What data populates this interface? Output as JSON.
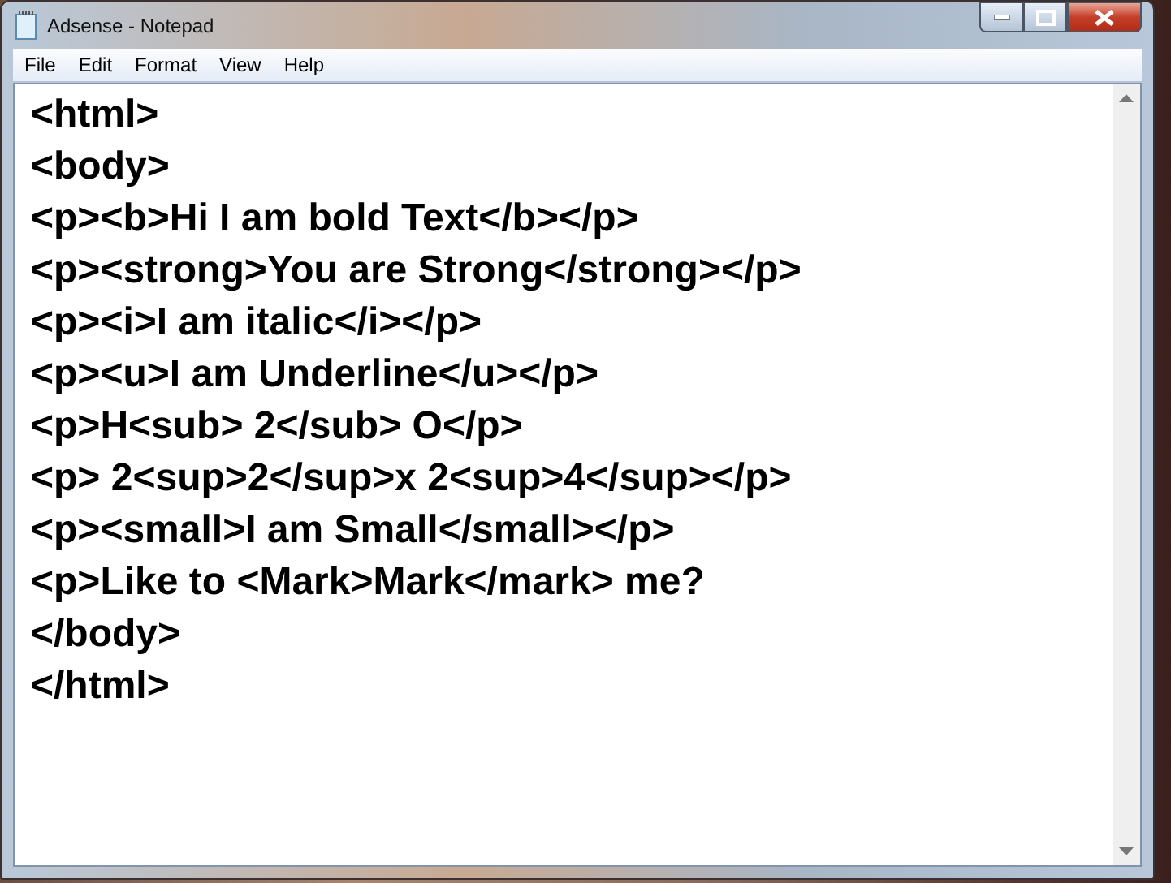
{
  "window": {
    "title": "Adsense - Notepad"
  },
  "menu": [
    "File",
    "Edit",
    "Format",
    "View",
    "Help"
  ],
  "editor": {
    "lines": [
      "<html>",
      "<body>",
      "<p><b>Hi I am bold Text</b></p>",
      "<p><strong>You are Strong</strong></p>",
      "<p><i>I am italic</i></p>",
      "<p><u>I am Underline</u></p>",
      "<p>H<sub> 2</sub> O</p>",
      "<p> 2<sup>2</sup>x 2<sup>4</sup></p>",
      "<p><small>I am Small</small></p>",
      "<p>Like to <Mark>Mark</mark> me?",
      "</body>",
      "</html>"
    ]
  }
}
